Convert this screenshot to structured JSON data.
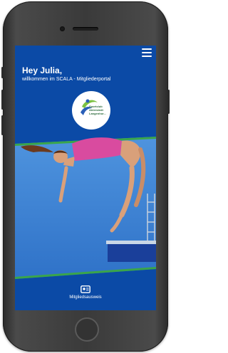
{
  "header": {
    "greeting": "Hey Julia,",
    "subline": "willkommen im SCALA - Mitgliederportal"
  },
  "logo": {
    "text_line1": "Sportclub",
    "text_line2": "Ahlerstedt",
    "text_line3": "Langenhor...",
    "brand_colors": {
      "swoosh_blue": "#2a5fb8",
      "swoosh_green": "#7cc242"
    }
  },
  "icons": {
    "menu": "hamburger-icon",
    "card": "member-card-icon"
  },
  "bottom_nav": {
    "label": "Mitgliedsausweis"
  },
  "colors": {
    "primary": "#0b4aa6",
    "accent_green": "#3aa54a",
    "sky": "#3a7fd0",
    "swimsuit": "#e0409a"
  }
}
